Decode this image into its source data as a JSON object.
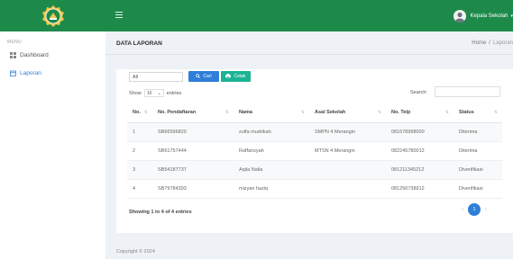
{
  "brand": {
    "logo_name": "emblem-logo",
    "color": "#1e8a4a"
  },
  "sidebar": {
    "menu_label": "MENU",
    "items": [
      {
        "label": "Dashboard",
        "icon": "grid-icon",
        "active": false
      },
      {
        "label": "Laporan",
        "icon": "calendar-icon",
        "active": true
      }
    ]
  },
  "topbar": {
    "user_name": "Kepala Sekolah"
  },
  "page": {
    "title": "DATA LAPORAN",
    "breadcrumb": [
      "Home",
      "Laporan"
    ]
  },
  "filters": {
    "select_value": "All",
    "search_button": "Cari",
    "print_button": "Cetak"
  },
  "table_controls": {
    "show_label": "Show",
    "entries_value": "10",
    "entries_label": "entries",
    "search_label": "Search:"
  },
  "table": {
    "columns": [
      "No.",
      "No. Pendaftaran",
      "Nama",
      "Asal Sekolah",
      "No. Telp",
      "Status"
    ],
    "rows": [
      [
        "1",
        "SB66596820",
        "zulfa mudrikah",
        "SMPN 4 Merangin",
        "081678998000",
        "Diterima"
      ],
      [
        "2",
        "SB61757444",
        "Raffansyah",
        "MTSN 4 Merangin",
        "082245780012",
        "Diterima"
      ],
      [
        "3",
        "SB54187737",
        "Aqila Nalia",
        "",
        "081211345212",
        "Diverifikasi"
      ],
      [
        "4",
        "SB79784393",
        "mizyan haziq",
        "",
        "081256738912",
        "Diverifikasi"
      ]
    ]
  },
  "pagination": {
    "info": "Showing 1 to 4 of 4 entries",
    "current_page": "1",
    "prev": "‹",
    "next": "›"
  },
  "footer": {
    "text": "Copyright © 2024"
  },
  "colors": {
    "primary": "#2f7fd8",
    "success": "#1bb394",
    "header": "#1e8a4a"
  }
}
